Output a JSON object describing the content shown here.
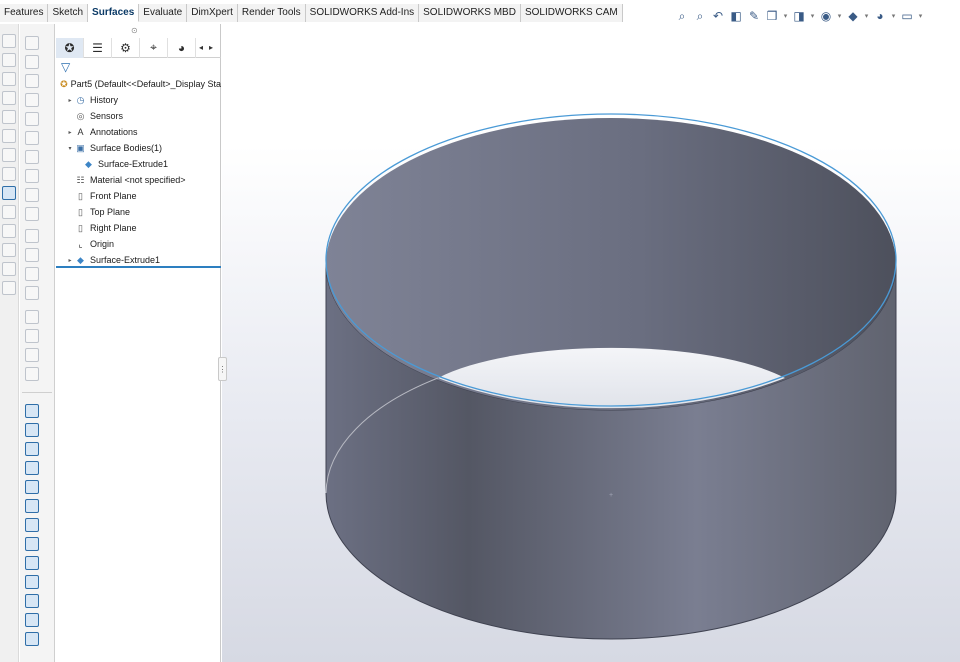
{
  "command_tabs": [
    {
      "label": "Features"
    },
    {
      "label": "Sketch"
    },
    {
      "label": "Surfaces",
      "active": true
    },
    {
      "label": "Evaluate"
    },
    {
      "label": "DimXpert"
    },
    {
      "label": "Render Tools"
    },
    {
      "label": "SOLIDWORKS Add-Ins"
    },
    {
      "label": "SOLIDWORKS MBD"
    },
    {
      "label": "SOLIDWORKS CAM"
    }
  ],
  "heads_up_toolbar": [
    {
      "icon": "zoom-to-fit-icon"
    },
    {
      "icon": "zoom-to-area-icon"
    },
    {
      "icon": "previous-view-icon"
    },
    {
      "icon": "section-view-icon"
    },
    {
      "icon": "dynamic-annotation-icon"
    },
    {
      "icon": "view-orientation-icon"
    },
    {
      "icon": "display-style-icon"
    },
    {
      "icon": "hide-show-items-icon"
    },
    {
      "icon": "edit-appearance-icon"
    },
    {
      "icon": "apply-scene-icon"
    },
    {
      "icon": "view-settings-icon"
    }
  ],
  "feature_manager": {
    "tabs": [
      "feature-manager-tree-icon",
      "property-manager-icon",
      "configuration-manager-icon",
      "dimxpert-manager-icon",
      "display-manager-icon"
    ],
    "tree": [
      {
        "label": "Part5  (Default<<Default>_Display Sta",
        "icon": "part-icon",
        "level": 0,
        "caret": ""
      },
      {
        "label": "History",
        "icon": "history-icon",
        "level": 1,
        "caret": "▸"
      },
      {
        "label": "Sensors",
        "icon": "sensors-icon",
        "level": 1,
        "caret": ""
      },
      {
        "label": "Annotations",
        "icon": "annotations-icon",
        "level": 1,
        "caret": "▸"
      },
      {
        "label": "Surface Bodies(1)",
        "icon": "surface-bodies-folder-icon",
        "level": 1,
        "caret": "▾"
      },
      {
        "label": "Surface-Extrude1",
        "icon": "surface-body-icon",
        "level": 2,
        "caret": ""
      },
      {
        "label": "Material <not specified>",
        "icon": "material-icon",
        "level": 1,
        "caret": ""
      },
      {
        "label": "Front Plane",
        "icon": "plane-icon",
        "level": 1,
        "caret": ""
      },
      {
        "label": "Top Plane",
        "icon": "plane-icon",
        "level": 1,
        "caret": ""
      },
      {
        "label": "Right Plane",
        "icon": "plane-icon",
        "level": 1,
        "caret": ""
      },
      {
        "label": "Origin",
        "icon": "origin-icon",
        "level": 1,
        "caret": ""
      },
      {
        "label": "Surface-Extrude1",
        "icon": "surface-extrude-feature-icon",
        "level": 1,
        "caret": "▸"
      }
    ]
  },
  "colors": {
    "accent": "#2d7fc0",
    "surface_edge": "#4a9ad6",
    "surface_dark": "#50535f",
    "surface_light": "#7b7f92"
  }
}
